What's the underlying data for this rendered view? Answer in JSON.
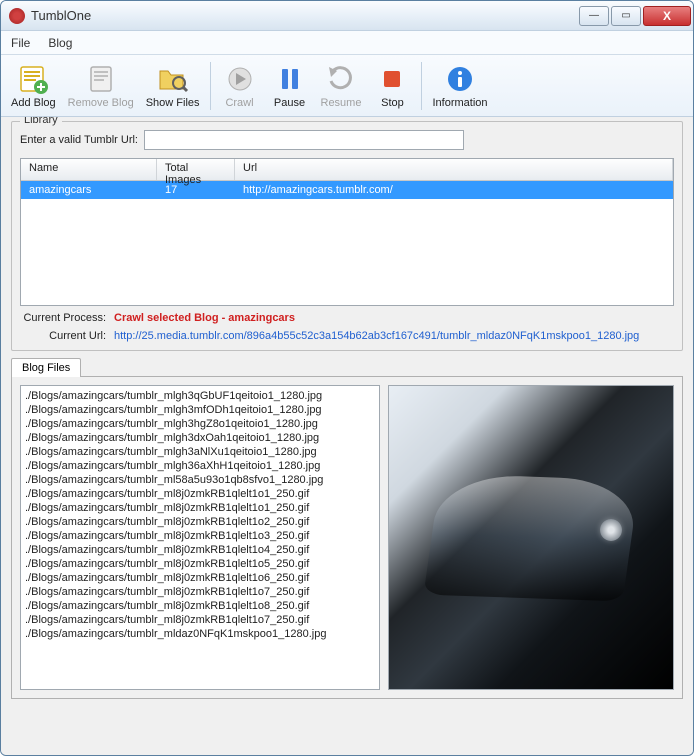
{
  "window": {
    "title": "TumblOne"
  },
  "menu": {
    "file": "File",
    "blog": "Blog"
  },
  "toolbar": {
    "add_blog": "Add Blog",
    "remove_blog": "Remove Blog",
    "show_files": "Show Files",
    "crawl": "Crawl",
    "pause": "Pause",
    "resume": "Resume",
    "stop": "Stop",
    "information": "Information"
  },
  "library": {
    "label": "Library",
    "url_label": "Enter a valid Tumblr Url:",
    "url_value": "",
    "columns": {
      "name": "Name",
      "total": "Total Images",
      "url": "Url"
    },
    "rows": [
      {
        "name": "amazingcars",
        "total": "17",
        "url": "http://amazingcars.tumblr.com/"
      }
    ],
    "current_process_label": "Current Process:",
    "current_process_value": "Crawl selected Blog - amazingcars",
    "current_url_label": "Current Url:",
    "current_url_value": "http://25.media.tumblr.com/896a4b55c52c3a154b62ab3cf167c491/tumblr_mldaz0NFqK1mskpoo1_1280.jpg"
  },
  "tabs": {
    "blog_files": "Blog Files"
  },
  "files": [
    "./Blogs/amazingcars/tumblr_mlgh3qGbUF1qeitoio1_1280.jpg",
    "./Blogs/amazingcars/tumblr_mlgh3mfODh1qeitoio1_1280.jpg",
    "./Blogs/amazingcars/tumblr_mlgh3hgZ8o1qeitoio1_1280.jpg",
    "./Blogs/amazingcars/tumblr_mlgh3dxOah1qeitoio1_1280.jpg",
    "./Blogs/amazingcars/tumblr_mlgh3aNlXu1qeitoio1_1280.jpg",
    "./Blogs/amazingcars/tumblr_mlgh36aXhH1qeitoio1_1280.jpg",
    "./Blogs/amazingcars/tumblr_ml58a5u93o1qb8sfvo1_1280.jpg",
    "./Blogs/amazingcars/tumblr_ml8j0zmkRB1qlelt1o1_250.gif",
    "./Blogs/amazingcars/tumblr_ml8j0zmkRB1qlelt1o1_250.gif",
    "./Blogs/amazingcars/tumblr_ml8j0zmkRB1qlelt1o2_250.gif",
    "./Blogs/amazingcars/tumblr_ml8j0zmkRB1qlelt1o3_250.gif",
    "./Blogs/amazingcars/tumblr_ml8j0zmkRB1qlelt1o4_250.gif",
    "./Blogs/amazingcars/tumblr_ml8j0zmkRB1qlelt1o5_250.gif",
    "./Blogs/amazingcars/tumblr_ml8j0zmkRB1qlelt1o6_250.gif",
    "./Blogs/amazingcars/tumblr_ml8j0zmkRB1qlelt1o7_250.gif",
    "./Blogs/amazingcars/tumblr_ml8j0zmkRB1qlelt1o8_250.gif",
    "./Blogs/amazingcars/tumblr_ml8j0zmkRB1qlelt1o7_250.gif",
    "./Blogs/amazingcars/tumblr_mldaz0NFqK1mskpoo1_1280.jpg"
  ]
}
